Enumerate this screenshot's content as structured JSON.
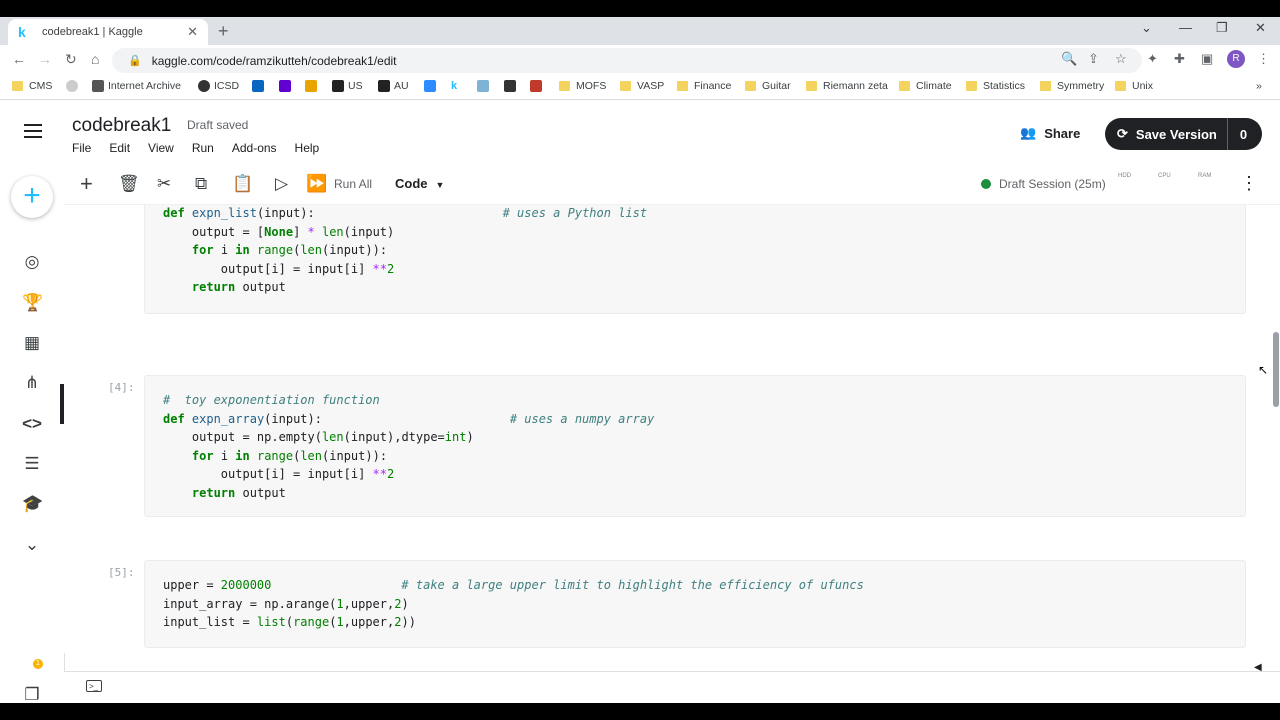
{
  "browser": {
    "tab_title": "codebreak1 | Kaggle",
    "tab_favicon": "k",
    "url": "kaggle.com/code/ramzikutteh/codebreak1/edit",
    "profile_initial": "R",
    "bookmarks": [
      "CMS",
      "Internet Archive",
      "ICSD",
      "US",
      "AU",
      "MOFS",
      "VASP",
      "Finance",
      "Guitar",
      "Riemann zeta",
      "Climate",
      "Statistics",
      "Symmetry",
      "Unix"
    ]
  },
  "header": {
    "title": "codebreak1",
    "status": "Draft saved",
    "menu": [
      "File",
      "Edit",
      "View",
      "Run",
      "Add-ons",
      "Help"
    ],
    "share_label": "Share",
    "save_label": "Save Version",
    "save_count": "0"
  },
  "toolbar": {
    "run_all": "Run All",
    "cell_type": "Code",
    "session": "Draft Session (25m)",
    "meters": [
      "HDD",
      "CPU",
      "RAM"
    ]
  },
  "cells": [
    {
      "prompt": ""
    },
    {
      "prompt": "[4]:"
    },
    {
      "prompt": "[5]:"
    }
  ],
  "sidebar": {
    "notification_count": "1"
  },
  "colors": {
    "kaggle_blue": "#20beff",
    "session_green": "#1e8e3e",
    "save_button": "#202124"
  }
}
